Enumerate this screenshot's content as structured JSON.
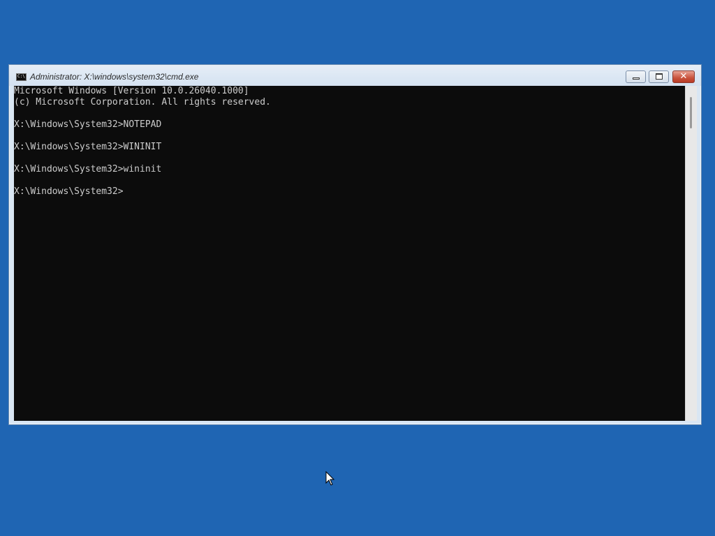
{
  "window": {
    "title": "Administrator: X:\\windows\\system32\\cmd.exe",
    "app_icon_text": "C:\\",
    "buttons": {
      "minimize": "minimize-icon",
      "maximize": "restore-icon",
      "close": "✕"
    }
  },
  "console": {
    "lines": [
      "Microsoft Windows [Version 10.0.26040.1000]",
      "(c) Microsoft Corporation. All rights reserved.",
      "",
      "X:\\Windows\\System32>NOTEPAD",
      "",
      "X:\\Windows\\System32>WININIT",
      "",
      "X:\\Windows\\System32>wininit",
      "",
      "X:\\Windows\\System32>"
    ]
  },
  "colors": {
    "desktop": "#1f65b3",
    "console_background": "#0c0c0c",
    "console_text": "#cccccc",
    "close_button": "#c9533d"
  }
}
